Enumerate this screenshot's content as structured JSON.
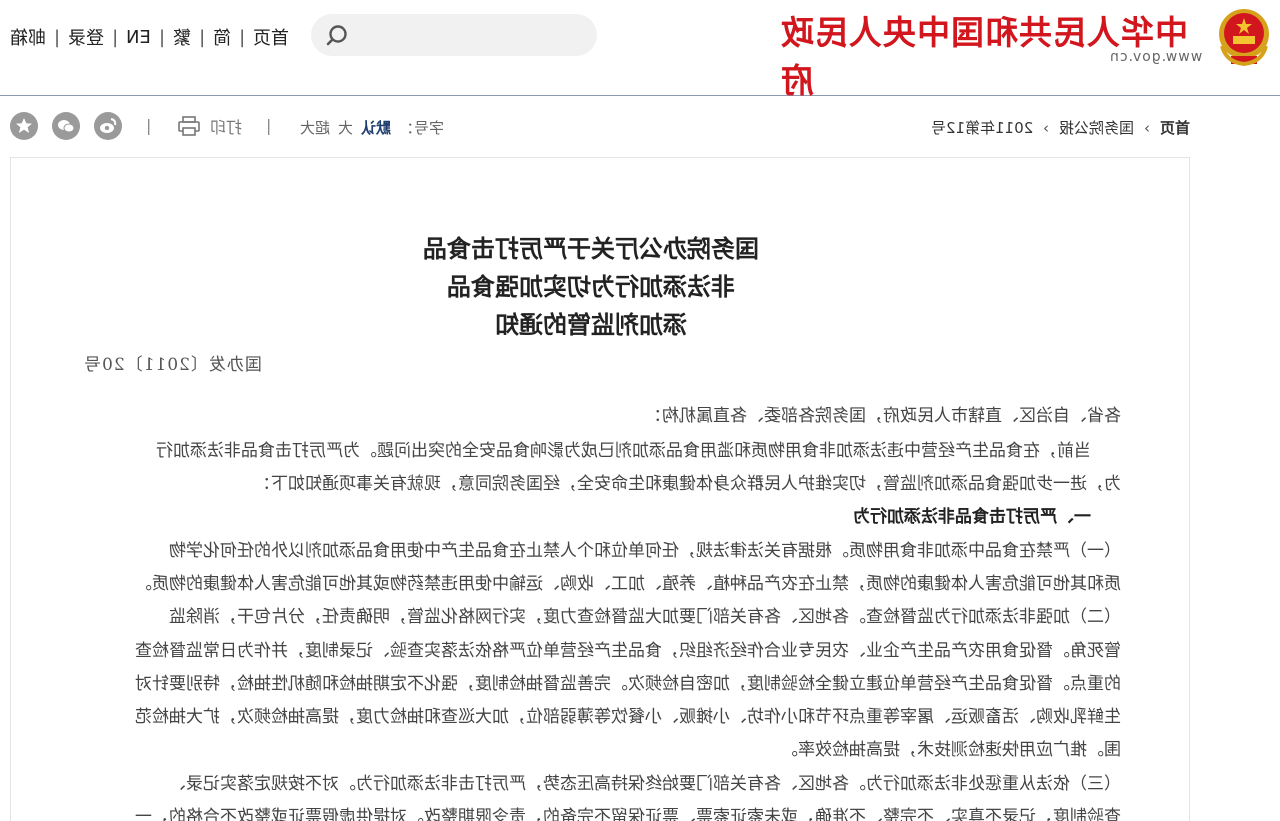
{
  "header": {
    "links": [
      "邮箱",
      "登录",
      "EN",
      "繁",
      "简",
      "首页"
    ],
    "search_placeholder": "",
    "logo_title": "中华人民共和国中央人民政府",
    "logo_url": "www.gov.cn"
  },
  "toolbar": {
    "share_icons": [
      "weibo-icon",
      "wechat-icon",
      "star-icon"
    ],
    "print_label": "打印",
    "font_label": "字号：",
    "font_options": [
      "默认",
      "大",
      "超大"
    ],
    "breadcrumb": [
      "首页",
      "国务院公报",
      "2011年第12号"
    ]
  },
  "article": {
    "title_lines": [
      "国务院办公厅关于严厉打击食品",
      "非法添加行为切实加强食品",
      "添加剂监管的通知"
    ],
    "doc_number": "国办发〔2011〕20号",
    "paragraphs": [
      "各省、自治区、直辖市人民政府，国务院各部委、各直属机构：",
      "当前，在食品生产经营中违法添加非食用物质和滥用食品添加剂已成为影响食品安全的突出问题。为严厉打击食品非法添加行",
      "为，进一步加强食品添加剂监管，切实维护人民群众身体健康和生命安全，经国务院同意，现就有关事项通知如下：",
      "一、严厉打击食品非法添加行为",
      "（一）严禁在食品中添加非食用物质。根据有关法律法规，任何单位和个人禁止在食品生产中使用食品添加剂以外的任何化学物",
      "质和其他可能危害人体健康的物质，禁止在农产品种植、养殖、加工、收购、运输中使用违禁药物或其他可能危害人体健康的物质。",
      "（二）加强非法添加行为监督检查。各地区、各有关部门要加大监督检查力度，实行网格化监管，明确责任，分片包干，消除监",
      "管死角。督促食用农产品生产企业、农民专业合作经济组织，食品生产经营单位严格依法落实查验、记录制度，并作为日常监督检查",
      "的重点。督促食品生产经营单位建立健全检验制度，加密自检频次。完善监督抽检制度，强化不定期抽检和随机性抽检，特别要针对",
      "生鲜乳收购、活畜贩运、屠宰等重点环节和小作坊、小摊贩、小餐饮等薄弱部位，加大巡查和抽检力度，提高抽检频次，扩大抽检范",
      "围。推广应用快速检测技术，提高抽检效率。",
      "（三）依法从重惩处非法添加行为。各地区、各有关部门要始终保持高压态势，严厉打击非法添加行为。对不按规定落实记录、",
      "查验制度，记录不真实、不完整、不准确，或未索证索票、票证保留不完备的，责令限期整改。对提供虚假票证或整改不合格的，一"
    ]
  }
}
